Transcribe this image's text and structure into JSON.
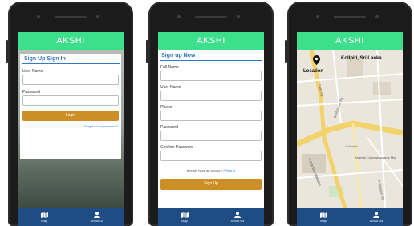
{
  "app_title": "AKSHI",
  "screen1": {
    "heading": "Sign Up Sign In",
    "username_label": "User Name",
    "password_label": "Password",
    "login_button": "Login",
    "forgot_link": "Forgot your password ?"
  },
  "screen2": {
    "heading": "Sign up Now",
    "fullname_label": "Full Name",
    "username_label": "User Name",
    "phone_label": "Phone",
    "password_label": "Password",
    "confirm_label": "Confirm Password",
    "account_text": "Already have an account ?",
    "signin_link": "Sign in",
    "signup_button": "Sign Up"
  },
  "screen3": {
    "location_title": "Kollpiti, Sri Lanka",
    "location_label": "Location",
    "road_names": [
      "Galle Rd",
      "St Michaels Rd",
      "Ananda Coomaraswamy Mw",
      "R A de Mel Mawatha",
      "Duplication Rd",
      "Colombo"
    ]
  },
  "tabbar": {
    "map_label": "Map",
    "about_label": "About Us"
  },
  "colors": {
    "appbar": "#3ddf8c",
    "tabbar": "#1f4c83",
    "button": "#cc8f25",
    "link": "#3677c2"
  }
}
